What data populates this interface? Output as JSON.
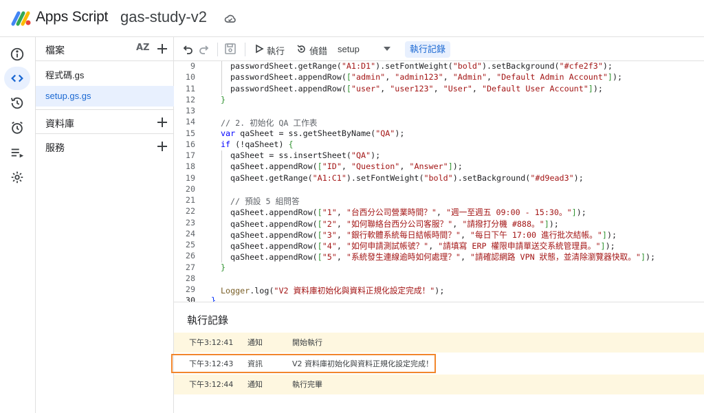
{
  "header": {
    "app_name": "Apps Script",
    "project_name": "gas-study-v2"
  },
  "rail": {
    "items": [
      {
        "icon": "info-icon"
      },
      {
        "icon": "code-icon",
        "active": true
      },
      {
        "icon": "history-icon"
      },
      {
        "icon": "alarm-icon"
      },
      {
        "icon": "executions-icon"
      },
      {
        "icon": "gear-icon"
      }
    ]
  },
  "files": {
    "title": "檔案",
    "sort_label": "AZ",
    "items": [
      {
        "name": "程式碼.gs",
        "active": false
      },
      {
        "name": "setup.gs.gs",
        "active": true
      }
    ],
    "sections": [
      {
        "label": "資料庫"
      },
      {
        "label": "服務"
      }
    ]
  },
  "toolbar": {
    "run_label": "執行",
    "debug_label": "偵錯",
    "function_select": "setup",
    "log_label": "執行記錄"
  },
  "editor": {
    "current_line": 30,
    "lines": [
      {
        "n": 9,
        "indent": 1,
        "html": "passwordSheet.getRange(<span class=\"str\">\"A1:D1\"</span>).setFontWeight(<span class=\"str\">\"bold\"</span>).setBackground(<span class=\"str\">\"#cfe2f3\"</span>);"
      },
      {
        "n": 10,
        "indent": 1,
        "html": "passwordSheet.appendRow(<span class=\"br2\">[</span><span class=\"str\">\"admin\"</span>, <span class=\"str\">\"admin123\"</span>, <span class=\"str\">\"Admin\"</span>, <span class=\"str\">\"Default Admin Account\"</span><span class=\"br2\">]</span>);"
      },
      {
        "n": 11,
        "indent": 1,
        "html": "passwordSheet.appendRow(<span class=\"br2\">[</span><span class=\"str\">\"user\"</span>, <span class=\"str\">\"user123\"</span>, <span class=\"str\">\"User\"</span>, <span class=\"str\">\"Default User Account\"</span><span class=\"br2\">]</span>);"
      },
      {
        "n": 12,
        "indent": 0,
        "html": "<span class=\"br2\">}</span>"
      },
      {
        "n": 13,
        "indent": 0,
        "html": ""
      },
      {
        "n": 14,
        "indent": 0,
        "html": "<span class=\"cm\">// 2. 初始化 QA 工作表</span>"
      },
      {
        "n": 15,
        "indent": 0,
        "html": "<span class=\"kw\">var</span> qaSheet = ss.getSheetByName(<span class=\"str\">\"QA\"</span>);"
      },
      {
        "n": 16,
        "indent": 0,
        "html": "<span class=\"kw\">if</span> (!qaSheet) <span class=\"br2\">{</span>"
      },
      {
        "n": 17,
        "indent": 1,
        "html": "qaSheet = ss.insertSheet(<span class=\"str\">\"QA\"</span>);"
      },
      {
        "n": 18,
        "indent": 1,
        "html": "qaSheet.appendRow(<span class=\"br2\">[</span><span class=\"str\">\"ID\"</span>, <span class=\"str\">\"Question\"</span>, <span class=\"str\">\"Answer\"</span><span class=\"br2\">]</span>);"
      },
      {
        "n": 19,
        "indent": 1,
        "html": "qaSheet.getRange(<span class=\"str\">\"A1:C1\"</span>).setFontWeight(<span class=\"str\">\"bold\"</span>).setBackground(<span class=\"str\">\"#d9ead3\"</span>);"
      },
      {
        "n": 20,
        "indent": 1,
        "html": ""
      },
      {
        "n": 21,
        "indent": 1,
        "html": "<span class=\"cm\">// 預設 5 組問答</span>"
      },
      {
        "n": 22,
        "indent": 1,
        "html": "qaSheet.appendRow(<span class=\"br2\">[</span><span class=\"str\">\"1\"</span>, <span class=\"str\">\"台西分公司營業時間？\"</span>, <span class=\"str\">\"週一至週五 09:00 - 15:30。\"</span><span class=\"br2\">]</span>);"
      },
      {
        "n": 23,
        "indent": 1,
        "html": "qaSheet.appendRow(<span class=\"br2\">[</span><span class=\"str\">\"2\"</span>, <span class=\"str\">\"如何聯絡台西分公司客服？\"</span>, <span class=\"str\">\"請撥打分機 #888。\"</span><span class=\"br2\">]</span>);"
      },
      {
        "n": 24,
        "indent": 1,
        "html": "qaSheet.appendRow(<span class=\"br2\">[</span><span class=\"str\">\"3\"</span>, <span class=\"str\">\"銀行軟體系統每日結帳時間？\"</span>, <span class=\"str\">\"每日下午 17:00 進行批次結帳。\"</span><span class=\"br2\">]</span>);"
      },
      {
        "n": 25,
        "indent": 1,
        "html": "qaSheet.appendRow(<span class=\"br2\">[</span><span class=\"str\">\"4\"</span>, <span class=\"str\">\"如何申請測試帳號？\"</span>, <span class=\"str\">\"請填寫 ERP 權限申請單送交系統管理員。\"</span><span class=\"br2\">]</span>);"
      },
      {
        "n": 26,
        "indent": 1,
        "html": "qaSheet.appendRow(<span class=\"br2\">[</span><span class=\"str\">\"5\"</span>, <span class=\"str\">\"系統發生連線逾時如何處理？\"</span>, <span class=\"str\">\"請確認網路 VPN 狀態，並清除瀏覽器快取。\"</span><span class=\"br2\">]</span>);"
      },
      {
        "n": 27,
        "indent": 0,
        "html": "<span class=\"br2\">}</span>"
      },
      {
        "n": 28,
        "indent": 0,
        "html": ""
      },
      {
        "n": 29,
        "indent": 0,
        "html": "<span class=\"fn\">Logger</span>.log(<span class=\"str\">\"V2 資料庫初始化與資料正規化設定完成！\"</span>);"
      },
      {
        "n": 30,
        "indent": -1,
        "html": "<span class=\"br\">}</span>"
      }
    ]
  },
  "log": {
    "title": "執行記錄",
    "entries": [
      {
        "time": "下午3:12:41",
        "level": "通知",
        "message": "開始執行",
        "kind": "warn"
      },
      {
        "time": "下午3:12:43",
        "level": "資訊",
        "message": "V2 資料庫初始化與資料正規化設定完成！",
        "kind": "info"
      },
      {
        "time": "下午3:12:44",
        "level": "通知",
        "message": "執行完畢",
        "kind": "warn"
      }
    ]
  },
  "colors": {
    "accent": "#1967d2",
    "active_bg": "#e8f0fe",
    "notice_bg": "#fef7e0",
    "highlight": "#f2862b"
  }
}
